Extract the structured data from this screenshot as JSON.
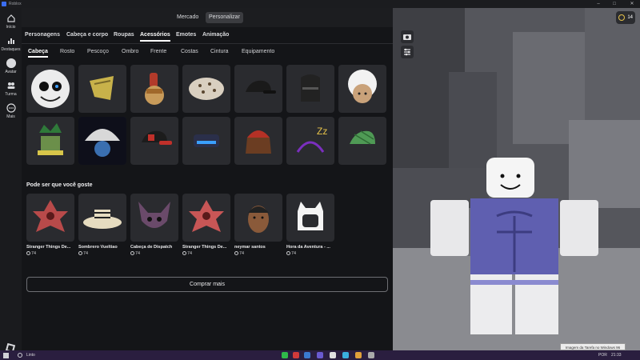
{
  "window": {
    "title": "Roblox",
    "controls": [
      "–",
      "□",
      "✕"
    ]
  },
  "sidebar": {
    "items": [
      {
        "label": "Início",
        "icon": "home-icon"
      },
      {
        "label": "Destaques",
        "icon": "charts-icon"
      },
      {
        "label": "Avatar",
        "icon": "avatar-icon"
      },
      {
        "label": "Turma",
        "icon": "people-icon"
      },
      {
        "label": "Mais",
        "icon": "more-icon"
      }
    ]
  },
  "top_tabs": {
    "items": [
      "Mercado",
      "Personalizar"
    ],
    "active": "Personalizar"
  },
  "category_tabs": {
    "items": [
      "Personagens",
      "Cabeça e corpo",
      "Roupas",
      "Acessórios",
      "Emotes",
      "Animação"
    ],
    "active": "Acessórios"
  },
  "sub_tabs": {
    "items": [
      "Cabeça",
      "Rosto",
      "Pescoço",
      "Ombro",
      "Frente",
      "Costas",
      "Cintura",
      "Equipamento"
    ],
    "active": "Cabeça"
  },
  "inventory": {
    "items": [
      {
        "icon": "skull-mask-icon",
        "color": "#e9e9e9"
      },
      {
        "icon": "yellow-helmet-icon",
        "color": "#c8b24a"
      },
      {
        "icon": "gladiator-helmet-icon",
        "color": "#b23a2a"
      },
      {
        "icon": "leopard-beanie-icon",
        "color": "#d9cfc0"
      },
      {
        "icon": "black-cap-icon",
        "color": "#1a1a1a"
      },
      {
        "icon": "knight-helmet-icon",
        "color": "#222222"
      },
      {
        "icon": "white-hair-icon",
        "color": "#f2f2f2"
      },
      {
        "icon": "green-crown-hair-icon",
        "color": "#2f7a3a"
      },
      {
        "icon": "mushroom-hat-icon",
        "color": "#d8d8d8"
      },
      {
        "icon": "red-cap-icon",
        "color": "#c0302a"
      },
      {
        "icon": "vr-headset-icon",
        "color": "#2a2f4a"
      },
      {
        "icon": "red-beanie-hair-icon",
        "color": "#b53126"
      },
      {
        "icon": "sleep-headband-icon",
        "color": "#7b2fbf"
      },
      {
        "icon": "green-plaid-cap-icon",
        "color": "#4f9a55"
      }
    ]
  },
  "recommendations": {
    "heading": "Pode ser que você goste",
    "items": [
      {
        "name": "Stranger Things De...",
        "price": "74",
        "icon": "demogorgon-head-icon"
      },
      {
        "name": "Sombrero Vueltiao",
        "price": "74",
        "icon": "sombrero-icon"
      },
      {
        "name": "Cabeça de Dispatch",
        "price": "74",
        "icon": "bat-head-icon"
      },
      {
        "name": "Stranger Things De...",
        "price": "74",
        "icon": "demogorgon-head-icon"
      },
      {
        "name": "neymar santos",
        "price": "74",
        "icon": "face-head-icon"
      },
      {
        "name": "Hora da Aventura - ...",
        "price": "74",
        "icon": "finn-hat-icon"
      }
    ]
  },
  "buy_more": {
    "label": "Comprar mais"
  },
  "robux": {
    "balance": "14"
  },
  "viewport": {
    "tools": [
      "camera-icon",
      "settings-sliders-icon"
    ]
  },
  "taskbar": {
    "search_text": "Linto",
    "tray": {
      "lang": "POR",
      "time": "21:33"
    },
    "tooltip": "Imagem da Tarefa no Windows 96"
  }
}
